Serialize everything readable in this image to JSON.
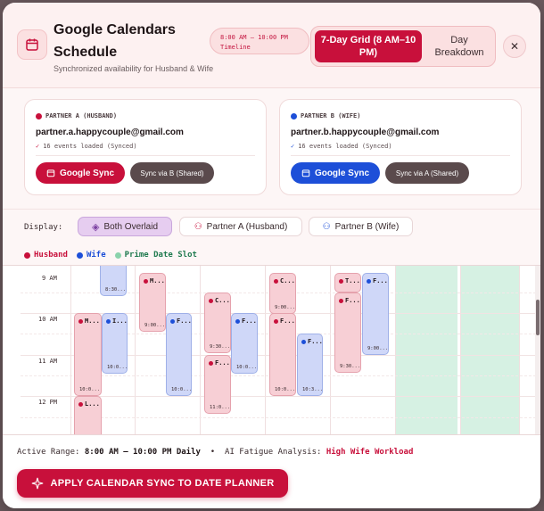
{
  "header": {
    "title": "Google Calendars Schedule",
    "subtitle": "Synchronized availability for Husband & Wife",
    "timeline_range": "8:00 AM – 10:00 PM",
    "timeline_label": "Timeline",
    "view_grid_label": "7-Day Grid (8 AM–10 PM)",
    "view_day_label": "Day Breakdown",
    "close_label": "✕"
  },
  "partners": [
    {
      "label": "PARTNER A (HUSBAND)",
      "email": "partner.a.happycouple@gmail.com",
      "events_status": "16 events loaded (Synced)",
      "google_sync_label": "Google Sync",
      "shared_sync_label": "Sync via B (Shared)",
      "color": "#c8103b"
    },
    {
      "label": "PARTNER B (WIFE)",
      "email": "partner.b.happycouple@gmail.com",
      "events_status": "16 events loaded (Synced)",
      "google_sync_label": "Google Sync",
      "shared_sync_label": "Sync via A (Shared)",
      "color": "#1d4fd8"
    }
  ],
  "display": {
    "label": "Display:",
    "options": [
      "Both Overlaid",
      "Partner A (Husband)",
      "Partner B (Wife)"
    ],
    "selected": "Both Overlaid"
  },
  "legend": {
    "husband": "Husband",
    "wife": "Wife",
    "prime": "Prime Date Slot",
    "husband_color": "#c8103b",
    "wife_color": "#1d4fd8",
    "prime_color": "#8ad2ab"
  },
  "grid": {
    "hours": [
      "9 AM",
      "10 AM",
      "11 AM",
      "12 PM"
    ],
    "events": [
      {
        "who": "w",
        "title": "",
        "sub": "8:30..."
      },
      {
        "who": "h",
        "title": "M...",
        "sub": "10:0..."
      },
      {
        "who": "w",
        "title": "I...",
        "sub": "10:0..."
      },
      {
        "who": "h",
        "title": "L...",
        "sub": ""
      },
      {
        "who": "h",
        "title": "M...",
        "sub": "9:00..."
      },
      {
        "who": "w",
        "title": "F...",
        "sub": "10:0..."
      },
      {
        "who": "h",
        "title": "C...",
        "sub": "9:30..."
      },
      {
        "who": "w",
        "title": "F...",
        "sub": "10:0..."
      },
      {
        "who": "h",
        "title": "F...",
        "sub": "11:0..."
      },
      {
        "who": "h",
        "title": "C...",
        "sub": "9:00..."
      },
      {
        "who": "h",
        "title": "F...",
        "sub": "10:0..."
      },
      {
        "who": "w",
        "title": "F...",
        "sub": "10:3..."
      },
      {
        "who": "h",
        "title": "T...",
        "sub": ""
      },
      {
        "who": "h",
        "title": "F...",
        "sub": "9:30..."
      },
      {
        "who": "w",
        "title": "F...",
        "sub": "9:00..."
      }
    ]
  },
  "footer": {
    "active_range_label": "Active Range:",
    "active_range_value": "8:00 AM – 10:00 PM Daily",
    "bullet": "•",
    "fatigue_label": "AI Fatigue Analysis:",
    "fatigue_value": "High Wife Workload",
    "apply_label": "APPLY CALENDAR SYNC TO DATE PLANNER"
  }
}
